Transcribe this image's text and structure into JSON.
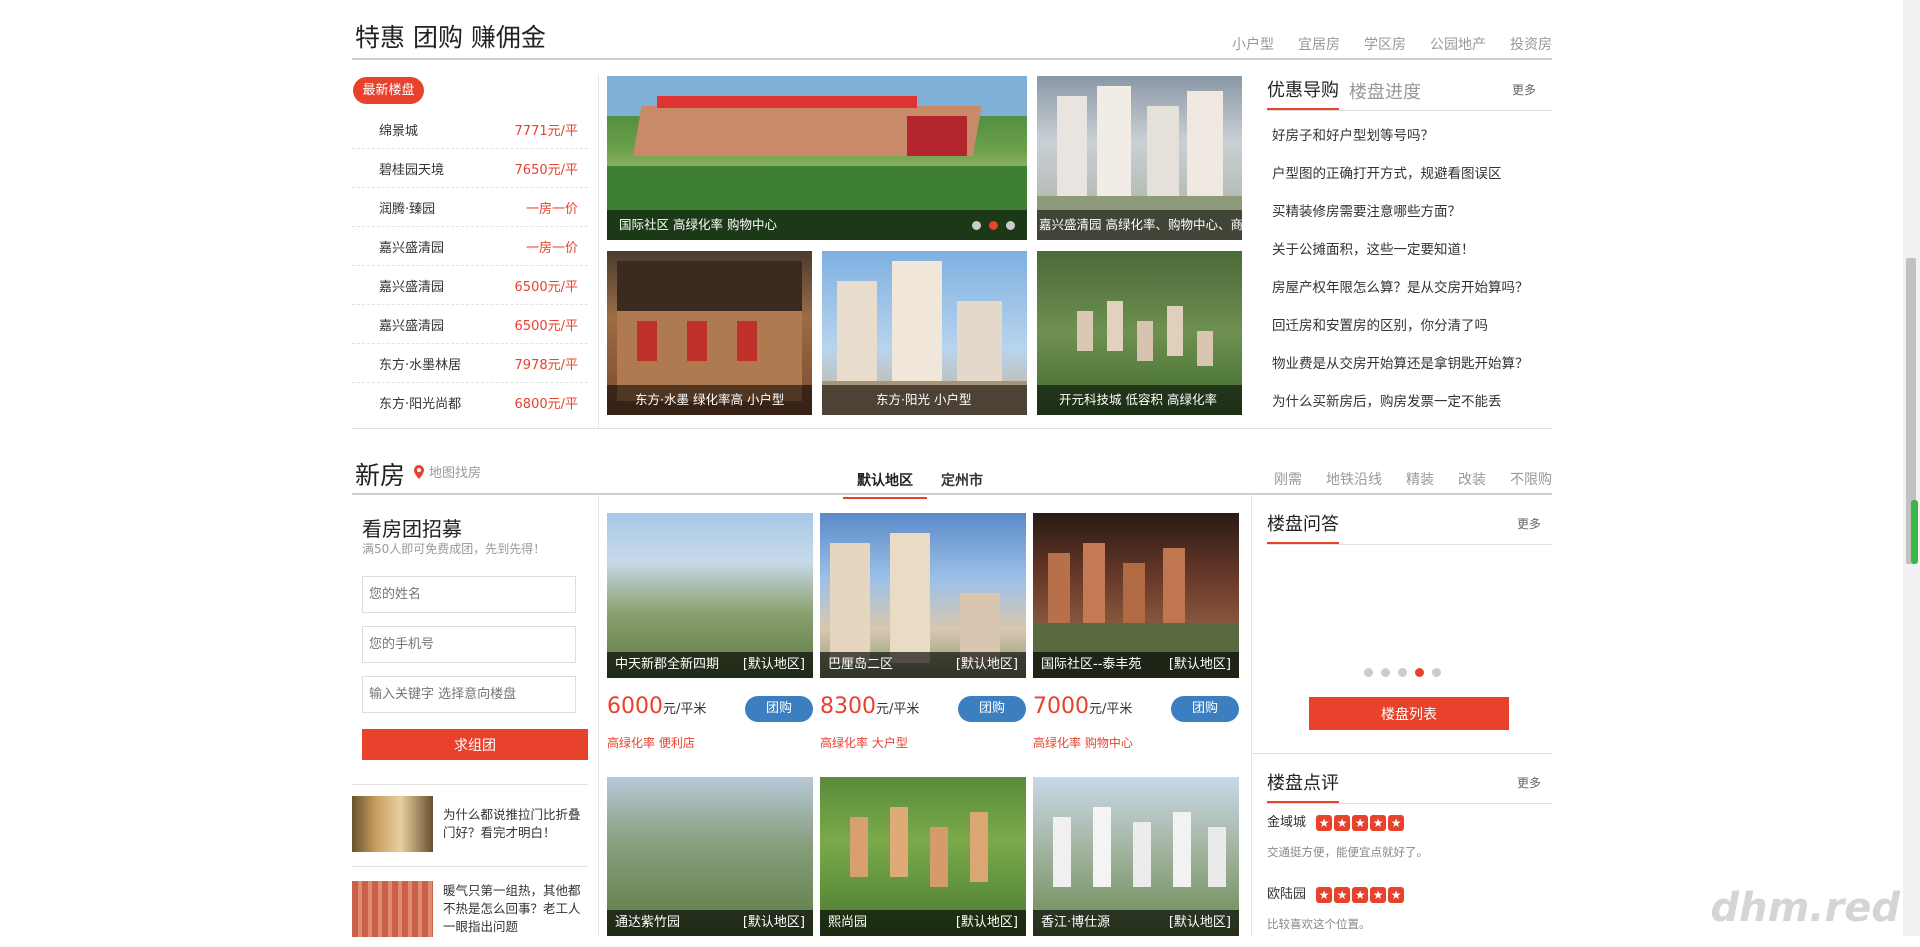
{
  "section1": {
    "title": "特惠 团购 赚佣金",
    "nav": [
      "小户型",
      "宜居房",
      "学区房",
      "公园地产",
      "投资房"
    ],
    "latest_label": "最新楼盘",
    "listings": [
      {
        "name": "绵景城",
        "price": "7771元/平"
      },
      {
        "name": "碧桂园天境",
        "price": "7650元/平"
      },
      {
        "name": "润腾·臻园",
        "price": "一房一价"
      },
      {
        "name": "嘉兴盛清园",
        "price": "一房一价"
      },
      {
        "name": "嘉兴盛清园",
        "price": "6500元/平"
      },
      {
        "name": "嘉兴盛清园",
        "price": "6500元/平"
      },
      {
        "name": "东方·水墨林居",
        "price": "7978元/平"
      },
      {
        "name": "东方·阳光尚都",
        "price": "6800元/平"
      }
    ],
    "tiles": [
      "国际社区   高绿化率 购物中心",
      "嘉兴盛清园   高绿化率、购物中心、商",
      "东方·水墨   绿化率高 小户型",
      "东方·阳光   小户型",
      "开元科技城   低容积 高绿化率"
    ],
    "tab_active": "优惠导购",
    "tab_inactive": "楼盘进度",
    "more": "更多",
    "news": [
      "好房子和好户型划等号吗？",
      "户型图的正确打开方式，规避看图误区",
      "买精装修房需要注意哪些方面？",
      "关于公摊面积，这些一定要知道！",
      "房屋产权年限怎么算？是从交房开始算吗？",
      "回迁房和安置房的区别，你分清了吗",
      "物业费是从交房开始算还是拿钥匙开始算？",
      "为什么买新房后，购房发票一定不能丢"
    ]
  },
  "section2": {
    "title": "新房",
    "map_link": "地图找房",
    "tabs": [
      "默认地区",
      "定州市"
    ],
    "nav": [
      "刚需",
      "地铁沿线",
      "精装",
      "改装",
      "不限购"
    ],
    "form": {
      "title": "看房团招募",
      "subtitle": "满50人即可免费成团，先到先得！",
      "name_placeholder": "您的姓名",
      "phone_placeholder": "您的手机号",
      "keyword_placeholder": "输入关键字 选择意向楼盘",
      "submit": "求组团"
    },
    "articles": [
      "为什么都说推拉门比折叠门好？看完才明白！",
      "暖气只第一组热，其他都不热是怎么回事？老工人一眼指出问题"
    ],
    "cards": [
      {
        "name": "中天新郡全新四期",
        "region": "[默认地区]",
        "price": "6000",
        "unit": "元/平米",
        "btn": "团购",
        "tags": "高绿化率 便利店"
      },
      {
        "name": "巴厘岛二区",
        "region": "[默认地区]",
        "price": "8300",
        "unit": "元/平米",
        "btn": "团购",
        "tags": "高绿化率 大户型"
      },
      {
        "name": "国际社区--泰丰苑",
        "region": "[默认地区]",
        "price": "7000",
        "unit": "元/平米",
        "btn": "团购",
        "tags": "高绿化率 购物中心"
      },
      {
        "name": "通达紫竹园",
        "region": "[默认地区]"
      },
      {
        "name": "熙尚园",
        "region": "[默认地区]"
      },
      {
        "name": "香江·博仕源",
        "region": "[默认地区]"
      }
    ],
    "qa_title": "楼盘问答",
    "qa_more": "更多",
    "list_button": "楼盘列表",
    "review_title": "楼盘点评",
    "review_more": "更多",
    "reviews": [
      {
        "name": "金域城",
        "rating": 5,
        "text": "交通挺方便，能便宜点就好了。"
      },
      {
        "name": "欧陆园",
        "rating": 5,
        "text": "比较喜欢这个位置。"
      }
    ],
    "star_glyph": "★"
  },
  "watermark": "dhm.red"
}
